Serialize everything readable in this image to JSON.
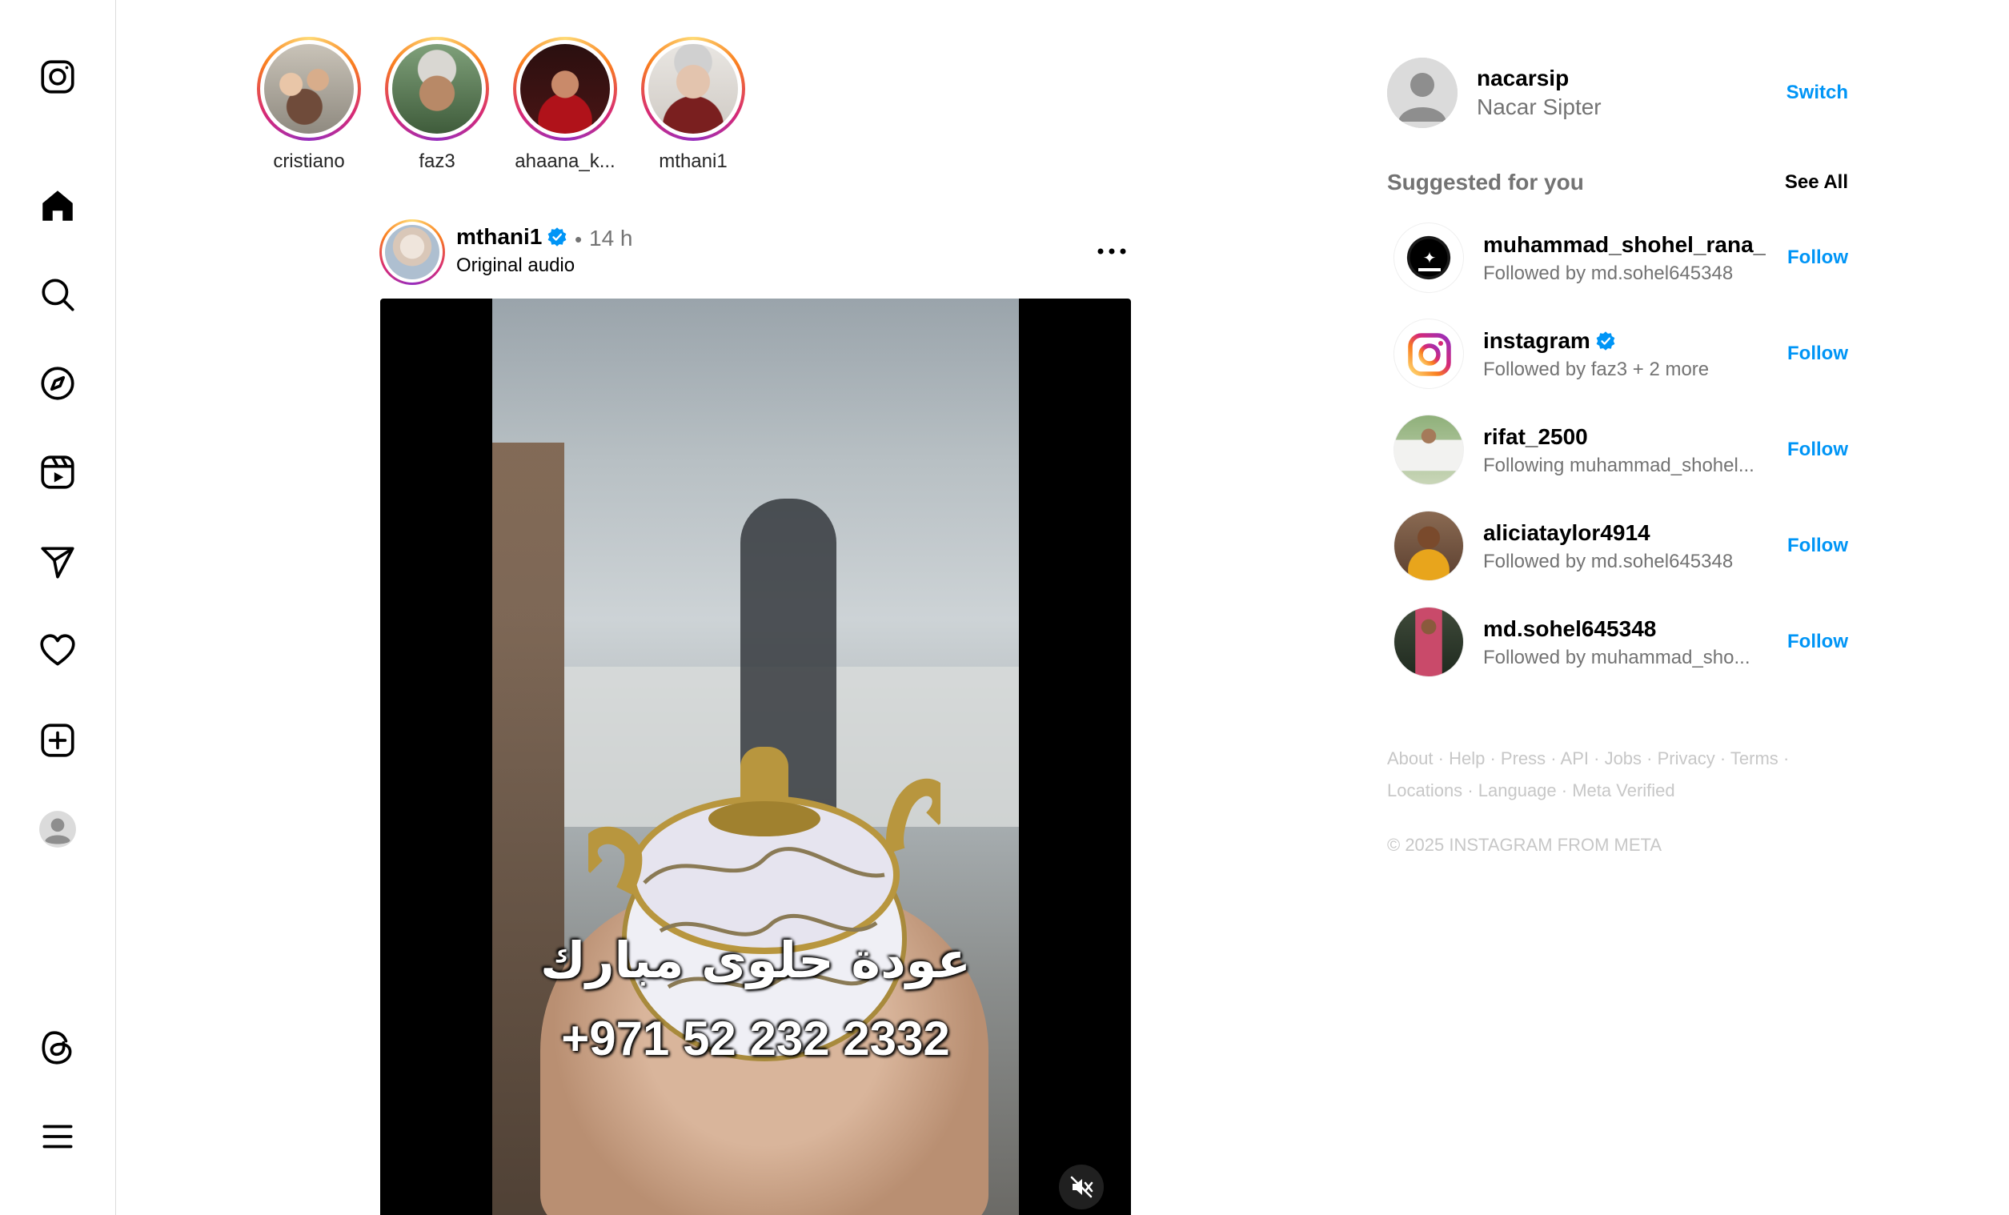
{
  "nav": {
    "items": [
      {
        "key": "instagram",
        "icon": "instagram-logo-icon"
      },
      {
        "key": "home",
        "icon": "home-icon"
      },
      {
        "key": "search",
        "icon": "search-icon"
      },
      {
        "key": "explore",
        "icon": "compass-icon"
      },
      {
        "key": "reels",
        "icon": "reels-icon"
      },
      {
        "key": "messages",
        "icon": "paper-plane-icon"
      },
      {
        "key": "notifications",
        "icon": "heart-icon"
      },
      {
        "key": "create",
        "icon": "plus-square-icon"
      },
      {
        "key": "profile",
        "icon": "avatar-icon"
      },
      {
        "key": "threads",
        "icon": "threads-icon"
      },
      {
        "key": "more",
        "icon": "menu-icon"
      }
    ]
  },
  "stories": [
    {
      "username": "cristiano"
    },
    {
      "username": "faz3"
    },
    {
      "username": "ahaana_k..."
    },
    {
      "username": "mthani1"
    }
  ],
  "post": {
    "username": "mthani1",
    "verified": true,
    "separator": "•",
    "time": "14 h",
    "audio": "Original audio",
    "overlay_arabic": "عودة حلوى مبارك",
    "overlay_phone": "+971 52 232 2332",
    "muted": true
  },
  "account": {
    "username": "nacarsip",
    "name": "Nacar Sipter",
    "switch_label": "Switch"
  },
  "suggestions": {
    "title": "Suggested for you",
    "see_all_label": "See All",
    "follow_label": "Follow",
    "items": [
      {
        "username": "muhammad_shohel_rana_",
        "verified": false,
        "subtitle": "Followed by md.sohel645348"
      },
      {
        "username": "instagram",
        "verified": true,
        "subtitle": "Followed by faz3 + 2 more"
      },
      {
        "username": "rifat_2500",
        "verified": false,
        "subtitle": "Following muhammad_shohel..."
      },
      {
        "username": "aliciataylor4914",
        "verified": false,
        "subtitle": "Followed by md.sohel645348"
      },
      {
        "username": "md.sohel645348",
        "verified": false,
        "subtitle": "Followed by muhammad_sho..."
      }
    ]
  },
  "footer": {
    "links": [
      "About",
      "Help",
      "Press",
      "API",
      "Jobs",
      "Privacy",
      "Terms",
      "Locations",
      "Language",
      "Meta Verified"
    ],
    "separator": "·",
    "copyright": "© 2025 INSTAGRAM FROM META"
  },
  "colors": {
    "link_blue": "#0095f6",
    "muted_text": "#737373",
    "footer_text": "#c7c7c7",
    "border": "#dbdbdb",
    "verified_blue": "#0095f6"
  }
}
